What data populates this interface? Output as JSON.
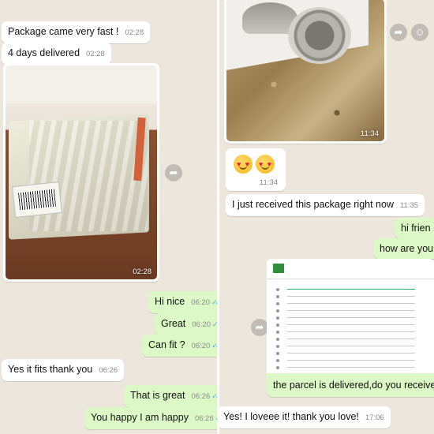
{
  "left": {
    "messages": [
      {
        "id": "l1",
        "dir": "in",
        "text": "Package came very fast !",
        "time": "02:28"
      },
      {
        "id": "l2",
        "dir": "in",
        "text": "4 days delivered",
        "time": "02:28"
      },
      {
        "id": "l3",
        "dir": "out",
        "text": "Hi nice",
        "time": "06:20"
      },
      {
        "id": "l4",
        "dir": "out",
        "text": "Great",
        "time": "06:20"
      },
      {
        "id": "l5",
        "dir": "out",
        "text": "Can fit ?",
        "time": "06:20"
      },
      {
        "id": "l6",
        "dir": "in",
        "text": "Yes it fits thank you",
        "time": "06:26"
      },
      {
        "id": "l7",
        "dir": "out",
        "text": "That is great",
        "time": "06:26"
      },
      {
        "id": "l8",
        "dir": "out",
        "text": "You happy I am happy",
        "time": "06:26"
      }
    ],
    "package_photo_time": "02:28"
  },
  "right": {
    "headphones_photo_time": "11:34",
    "emoji_time": "11:34",
    "messages": [
      {
        "id": "r1",
        "dir": "in",
        "text": "I just received this package right now",
        "time": "11:35"
      },
      {
        "id": "r2",
        "dir": "out",
        "text": "hi frien",
        "time": ""
      },
      {
        "id": "r3",
        "dir": "out",
        "text": "how are you",
        "time": ""
      },
      {
        "id": "r4",
        "dir": "out",
        "text": "the parcel is delivered,do you receive?",
        "time": ""
      },
      {
        "id": "r5",
        "dir": "in",
        "text": "Yes! I loveee it! thank you love!",
        "time": "17:06"
      }
    ]
  },
  "icons": {
    "forward": "forward-icon",
    "emoji_react": "emoji-react-icon",
    "read_receipt": "double-check-icon"
  },
  "colors": {
    "chat_bg": "#ece6dd",
    "incoming": "#ffffff",
    "outgoing": "#dcf8c6",
    "read_tick": "#4fa3e3"
  }
}
